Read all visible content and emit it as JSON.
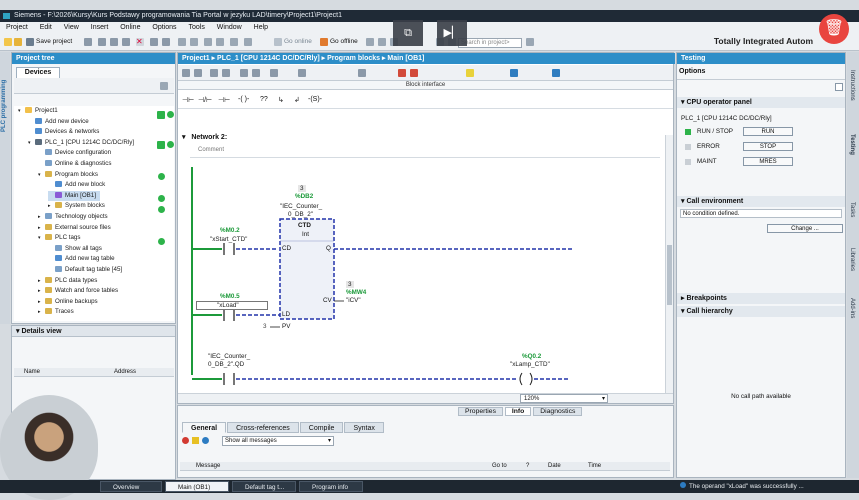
{
  "window": {
    "title": "Siemens  -  F:\\2026\\Kursy\\Kurs Podstawy programowania Tia Portal w jezyku LAD\\timery\\Project1\\Project1",
    "brand": "Totally Integrated Autom"
  },
  "menu": [
    "Project",
    "Edit",
    "View",
    "Insert",
    "Online",
    "Options",
    "Tools",
    "Window",
    "Help"
  ],
  "toolbar": {
    "save_label": "Save project",
    "go_online": "Go online",
    "go_offline": "Go offline",
    "search_placeholder": "Search in project>"
  },
  "project_tree": {
    "title": "Project tree",
    "tab": "Devices",
    "side_label": "PLC programming",
    "items": [
      {
        "label": "Project1",
        "indent": 0
      },
      {
        "label": "Add new device",
        "indent": 1
      },
      {
        "label": "Devices & networks",
        "indent": 1
      },
      {
        "label": "PLC_1 [CPU 1214C DC/DC/Rly]",
        "indent": 1
      },
      {
        "label": "Device configuration",
        "indent": 2
      },
      {
        "label": "Online & diagnostics",
        "indent": 2
      },
      {
        "label": "Program blocks",
        "indent": 2
      },
      {
        "label": "Add new block",
        "indent": 3
      },
      {
        "label": "Main [OB1]",
        "indent": 3
      },
      {
        "label": "System blocks",
        "indent": 3
      },
      {
        "label": "Technology objects",
        "indent": 2
      },
      {
        "label": "External source files",
        "indent": 2
      },
      {
        "label": "PLC tags",
        "indent": 2
      },
      {
        "label": "Show all tags",
        "indent": 3
      },
      {
        "label": "Add new tag table",
        "indent": 3
      },
      {
        "label": "Default tag table [45]",
        "indent": 3
      },
      {
        "label": "PLC data types",
        "indent": 2
      },
      {
        "label": "Watch and force tables",
        "indent": 2
      },
      {
        "label": "Online backups",
        "indent": 2
      },
      {
        "label": "Traces",
        "indent": 2
      }
    ]
  },
  "details_view": {
    "title": "Details view",
    "col_name": "Name",
    "col_address": "Address"
  },
  "editor": {
    "breadcrumb": "Project1  ▸  PLC_1 [CPU 1214C DC/DC/Rly]  ▸  Program blocks  ▸  Main [OB1]",
    "block_interface": "Block interface",
    "network": "Network 2:",
    "comment": "Comment",
    "zoom": "120%",
    "rung1": {
      "db_num": "3",
      "db_addr": "%DB2",
      "db_name1": "\"IEC_Counter_",
      "db_name2": "0_DB_2\"",
      "block_type": "CTD",
      "block_dtype": "Int",
      "in1_addr": "%M0.2",
      "in1_tag": "\"xStart_CTD\"",
      "in2_addr": "%M0.5",
      "in2_tag": "\"xLoad\"",
      "pin_cd": "CD",
      "pin_q": "Q",
      "pin_ld": "LD",
      "pin_pv": "PV",
      "pin_cv": "CV",
      "pv_val": "3",
      "cv_num": "3",
      "cv_addr": "%MW4",
      "cv_tag": "\"iCV\""
    },
    "rung2": {
      "in_tag1": "\"IEC_Counter_",
      "in_tag2": "0_DB_2\".QD",
      "out_addr": "%Q0.2",
      "out_tag": "\"xLamp_CTD\""
    }
  },
  "testing": {
    "title": "Testing",
    "options": "Options",
    "cpu_panel": "CPU operator panel",
    "cpu_name": "PLC_1 [CPU 1214C DC/DC/Rly]",
    "run_stop": "RUN / STOP",
    "run_btn": "RUN",
    "error": "ERROR",
    "stop_btn": "STOP",
    "maint": "MAINT",
    "mres_btn": "MRES",
    "call_env": "Call environment",
    "no_condition": "No condition defined.",
    "change_btn": "Change ...",
    "breakpoints": "Breakpoints",
    "call_hierarchy": "Call hierarchy",
    "no_call_path": "No call path available",
    "side_tabs": [
      "Instructions",
      "Testing",
      "Tasks",
      "Libraries",
      "Add-ins"
    ]
  },
  "inspector": {
    "top_tabs": [
      "Properties",
      "Info",
      "Diagnostics"
    ],
    "tabs": [
      "General",
      "Cross-references",
      "Compile",
      "Syntax"
    ],
    "filter": "Show all messages",
    "cols": [
      "Message",
      "Go to",
      "?",
      "Date",
      "Time"
    ]
  },
  "taskbar": {
    "items": [
      "Overview",
      "Main (OB1)",
      "Default tag t...",
      "Program info"
    ],
    "status": "The operand \"xLoad\" was successfully ..."
  }
}
